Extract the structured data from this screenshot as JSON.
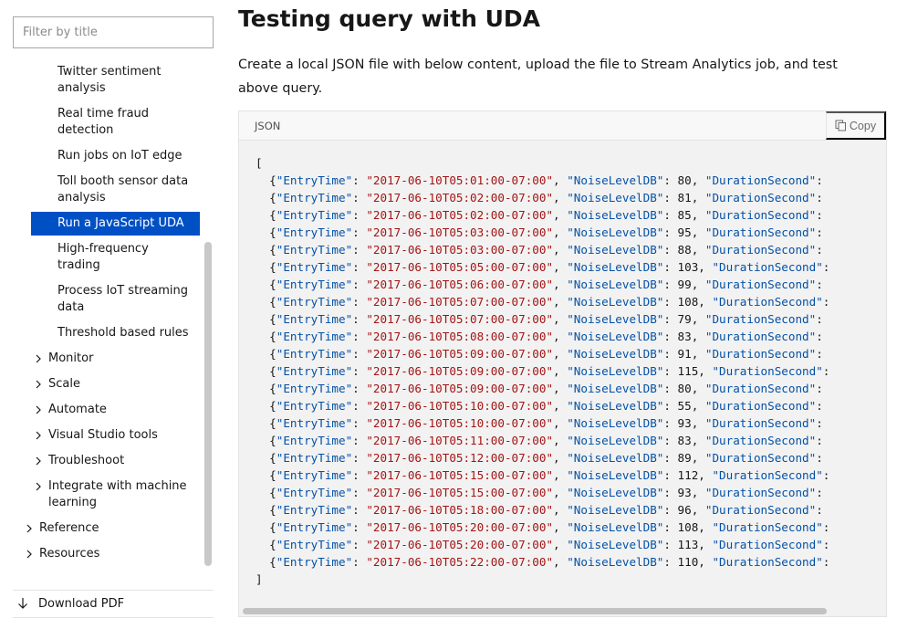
{
  "sidebar": {
    "filter_placeholder": "Filter by title",
    "items": [
      {
        "label": "Twitter sentiment analysis",
        "kind": "sub"
      },
      {
        "label": "Real time fraud detection",
        "kind": "sub"
      },
      {
        "label": "Run jobs on IoT edge",
        "kind": "sub"
      },
      {
        "label": "Toll booth sensor data analysis",
        "kind": "sub"
      },
      {
        "label": "Run a JavaScript UDA",
        "kind": "active"
      },
      {
        "label": "High-frequency trading",
        "kind": "sub"
      },
      {
        "label": "Process IoT streaming data",
        "kind": "sub"
      },
      {
        "label": "Threshold based rules",
        "kind": "sub"
      },
      {
        "label": "Monitor",
        "kind": "group"
      },
      {
        "label": "Scale",
        "kind": "group"
      },
      {
        "label": "Automate",
        "kind": "group"
      },
      {
        "label": "Visual Studio tools",
        "kind": "group"
      },
      {
        "label": "Troubleshoot",
        "kind": "group"
      },
      {
        "label": "Integrate with machine learning",
        "kind": "group"
      },
      {
        "label": "Reference",
        "kind": "top"
      },
      {
        "label": "Resources",
        "kind": "top"
      }
    ],
    "download_pdf_label": "Download PDF"
  },
  "main": {
    "title": "Testing query with UDA",
    "intro": "Create a local JSON file with below content, upload the file to Stream Analytics job, and test above query.",
    "code": {
      "language": "JSON",
      "copy_label": "Copy",
      "open_bracket": "[",
      "close_bracket": "]",
      "key_entry": "\"EntryTime\"",
      "key_noise": "\"NoiseLevelDB\"",
      "key_duration": "\"DurationSecond\"",
      "rows": [
        {
          "time": "\"2017-06-10T05:01:00-07:00\"",
          "noise": "80"
        },
        {
          "time": "\"2017-06-10T05:02:00-07:00\"",
          "noise": "81"
        },
        {
          "time": "\"2017-06-10T05:02:00-07:00\"",
          "noise": "85"
        },
        {
          "time": "\"2017-06-10T05:03:00-07:00\"",
          "noise": "95"
        },
        {
          "time": "\"2017-06-10T05:03:00-07:00\"",
          "noise": "88"
        },
        {
          "time": "\"2017-06-10T05:05:00-07:00\"",
          "noise": "103"
        },
        {
          "time": "\"2017-06-10T05:06:00-07:00\"",
          "noise": "99"
        },
        {
          "time": "\"2017-06-10T05:07:00-07:00\"",
          "noise": "108"
        },
        {
          "time": "\"2017-06-10T05:07:00-07:00\"",
          "noise": "79"
        },
        {
          "time": "\"2017-06-10T05:08:00-07:00\"",
          "noise": "83"
        },
        {
          "time": "\"2017-06-10T05:09:00-07:00\"",
          "noise": "91"
        },
        {
          "time": "\"2017-06-10T05:09:00-07:00\"",
          "noise": "115"
        },
        {
          "time": "\"2017-06-10T05:09:00-07:00\"",
          "noise": "80"
        },
        {
          "time": "\"2017-06-10T05:10:00-07:00\"",
          "noise": "55"
        },
        {
          "time": "\"2017-06-10T05:10:00-07:00\"",
          "noise": "93"
        },
        {
          "time": "\"2017-06-10T05:11:00-07:00\"",
          "noise": "83"
        },
        {
          "time": "\"2017-06-10T05:12:00-07:00\"",
          "noise": "89"
        },
        {
          "time": "\"2017-06-10T05:15:00-07:00\"",
          "noise": "112"
        },
        {
          "time": "\"2017-06-10T05:15:00-07:00\"",
          "noise": "93"
        },
        {
          "time": "\"2017-06-10T05:18:00-07:00\"",
          "noise": "96"
        },
        {
          "time": "\"2017-06-10T05:20:00-07:00\"",
          "noise": "108"
        },
        {
          "time": "\"2017-06-10T05:20:00-07:00\"",
          "noise": "113"
        },
        {
          "time": "\"2017-06-10T05:22:00-07:00\"",
          "noise": "110"
        }
      ]
    }
  },
  "colors": {
    "accent": "#0050c5",
    "json_key": "#0451a5",
    "json_string": "#a31515"
  },
  "icons": {
    "chevron": "chevron-right-icon",
    "download": "download-arrow-icon",
    "copy": "copy-icon"
  }
}
